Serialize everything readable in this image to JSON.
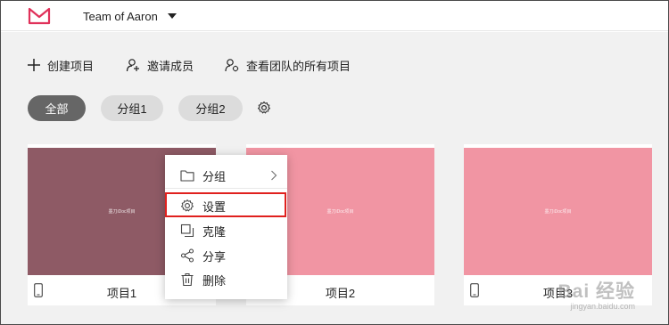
{
  "header": {
    "team_name": "Team of Aaron"
  },
  "actions": [
    {
      "label": "创建项目",
      "icon": "plus-icon"
    },
    {
      "label": "邀请成员",
      "icon": "add-user-icon"
    },
    {
      "label": "查看团队的所有项目",
      "icon": "team-projects-icon"
    }
  ],
  "filters": [
    {
      "label": "全部",
      "active": true
    },
    {
      "label": "分组1",
      "active": false
    },
    {
      "label": "分组2",
      "active": false
    }
  ],
  "projects": [
    {
      "name": "项目1",
      "thumb_text": "墨刀iDoc项目",
      "color": "#8e5a65",
      "device": "phone-icon"
    },
    {
      "name": "项目2",
      "thumb_text": "墨刀iDoc项目",
      "color": "#f195a3",
      "device": "phone-icon"
    },
    {
      "name": "项目3",
      "thumb_text": "墨刀iDoc项目",
      "color": "#f195a3",
      "device": "phone-icon"
    }
  ],
  "context_menu": {
    "items": [
      {
        "label": "分组",
        "icon": "folder-icon",
        "submenu": true
      },
      {
        "label": "设置",
        "icon": "gear-icon",
        "highlighted": true
      },
      {
        "label": "克隆",
        "icon": "clone-icon"
      },
      {
        "label": "分享",
        "icon": "share-icon"
      },
      {
        "label": "删除",
        "icon": "trash-icon"
      }
    ]
  },
  "watermark": {
    "main": "Bai 经验",
    "sub": "jingyan.baidu.com"
  },
  "colors": {
    "brand": "#e0315a",
    "highlight_border": "#e0201e",
    "active_pill": "#666666"
  }
}
